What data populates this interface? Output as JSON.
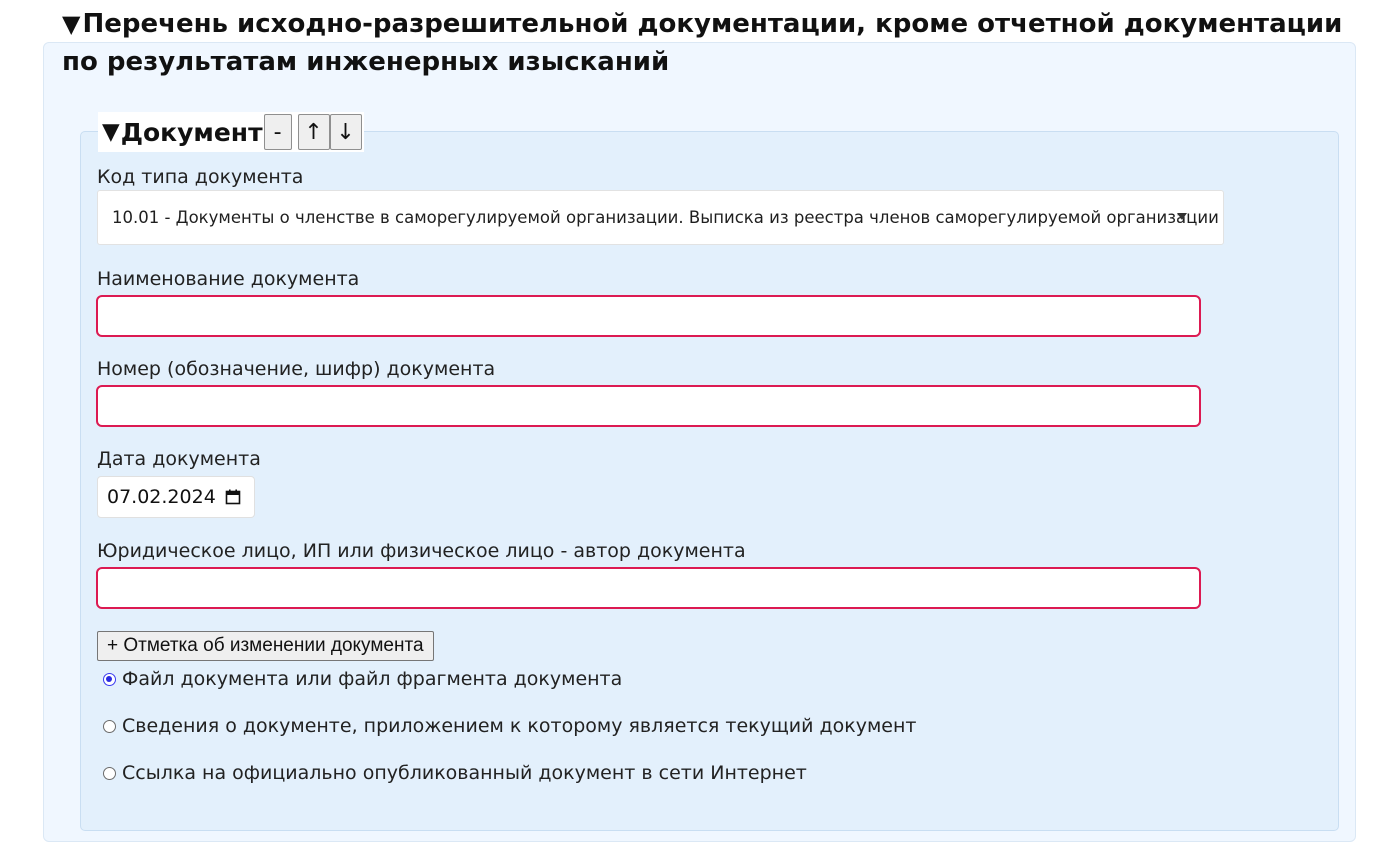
{
  "section": {
    "toggle_symbol": "▼",
    "title": "Перечень исходно-разрешительной документации, кроме отчетной документации по результатам инженерных изысканий"
  },
  "document": {
    "toggle_symbol": "▼",
    "title": "Документ",
    "remove_label": "-",
    "move_up_label": "↑",
    "move_down_label": "↓"
  },
  "fields": {
    "doc_type_label": "Код типа документа",
    "doc_type_value": "10.01 - Документы о членстве в саморегулируемой организации. Выписка из реестра членов саморегулируемой организации",
    "doc_name_label": "Наименование документа",
    "doc_name_value": "",
    "doc_number_label": "Номер (обозначение, шифр) документа",
    "doc_number_value": "",
    "doc_date_label": "Дата документа",
    "doc_date_value": "07.02.2024",
    "author_label": "Юридическое лицо, ИП или физическое лицо - автор документа",
    "author_value": ""
  },
  "add_change_button": "+ Отметка об изменении документа",
  "radio_options": [
    {
      "label": "Файл документа или файл фрагмента документа",
      "checked": true
    },
    {
      "label": "Сведения о документе, приложением к которому является текущий документ",
      "checked": false
    },
    {
      "label": "Ссылка на официально опубликованный документ в сети Интернет",
      "checked": false
    }
  ],
  "colors": {
    "required_border": "#dc1a52",
    "outer_panel_bg": "#f0f7ff",
    "inner_panel_bg": "#e3f0fc",
    "radio_checked": "#2a2ae0"
  }
}
